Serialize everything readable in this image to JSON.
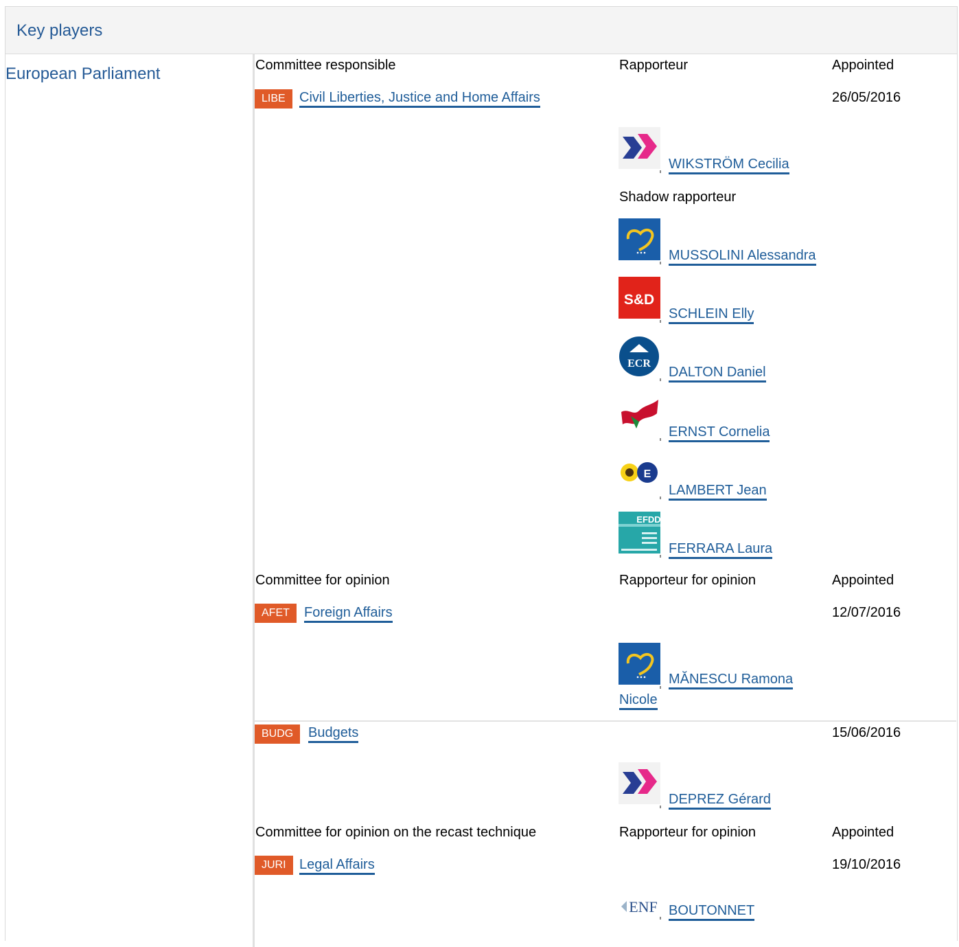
{
  "header": {
    "title": "Key players"
  },
  "institution": {
    "name": "European Parliament"
  },
  "labels": {
    "committee_responsible": "Committee responsible",
    "committee_opinion": "Committee for opinion",
    "committee_recast": "Committee for opinion on the recast technique",
    "rapporteur": "Rapporteur",
    "rapporteur_opinion": "Rapporteur for opinion",
    "shadow_rapporteur": "Shadow rapporteur",
    "appointed": "Appointed"
  },
  "committees": [
    {
      "code": "LIBE",
      "name": "Civil Liberties, Justice and Home Affairs",
      "appointed": "26/05/2016",
      "rapporteurs": [
        {
          "name": "WIKSTRÖM Cecilia",
          "group_icon": "alde-icon"
        }
      ],
      "shadows": [
        {
          "name": "MUSSOLINI Alessandra",
          "group_icon": "epp-icon"
        },
        {
          "name": "SCHLEIN Elly",
          "group_icon": "sd-icon"
        },
        {
          "name": "DALTON Daniel",
          "group_icon": "ecr-icon"
        },
        {
          "name": "ERNST Cornelia",
          "group_icon": "gue-ngl-icon"
        },
        {
          "name": "LAMBERT Jean",
          "group_icon": "greens-efa-icon"
        },
        {
          "name": "FERRARA Laura",
          "group_icon": "efdd-icon"
        }
      ]
    },
    {
      "code": "AFET",
      "name": "Foreign Affairs",
      "appointed": "12/07/2016",
      "rapporteurs": [
        {
          "name_line1": "MĂNESCU Ramona",
          "name_line2": "Nicole",
          "group_icon": "epp-icon"
        }
      ]
    },
    {
      "code": "BUDG",
      "name": "Budgets",
      "appointed": "15/06/2016",
      "rapporteurs": [
        {
          "name": "DEPREZ Gérard",
          "group_icon": "alde-icon"
        }
      ]
    },
    {
      "code": "JURI",
      "name": "Legal Affairs",
      "appointed": "19/10/2016",
      "rapporteurs": [
        {
          "name": "BOUTONNET",
          "group_icon": "enf-icon"
        }
      ]
    }
  ],
  "logo_text": {
    "sd": "S&D",
    "ecr": "ECR",
    "efdd": "EFDD",
    "enf": "ENF"
  },
  "colors": {
    "link": "#1f5d99",
    "tag": "#e05a28",
    "header_bg": "#f4f4f4"
  }
}
